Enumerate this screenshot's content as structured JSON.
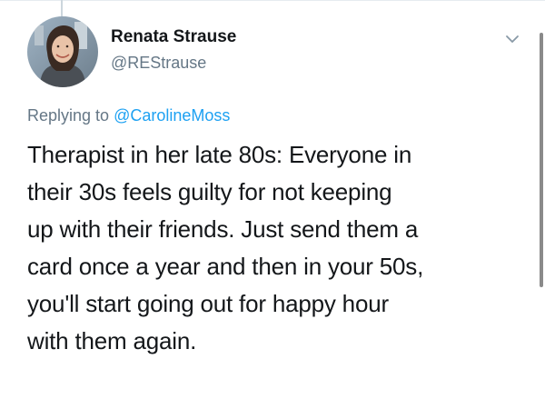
{
  "tweet": {
    "author": {
      "display_name": "Renata Strause",
      "handle": "@REStrause",
      "avatar_icon": "avatar-photo"
    },
    "reply_context": {
      "prefix": "Replying to",
      "mention": "@CarolineMoss"
    },
    "text_lines": [
      "Therapist in her late 80s:  Everyone in",
      "their 30s feels guilty for not keeping",
      "up with their friends. Just send them a",
      "card once a year and then in your 50s,",
      "you'll start going out for happy hour",
      "with them again."
    ],
    "menu_icon": "chevron-down-icon"
  },
  "colors": {
    "text_primary": "#14171a",
    "text_secondary": "#657786",
    "link": "#1da1f2"
  }
}
